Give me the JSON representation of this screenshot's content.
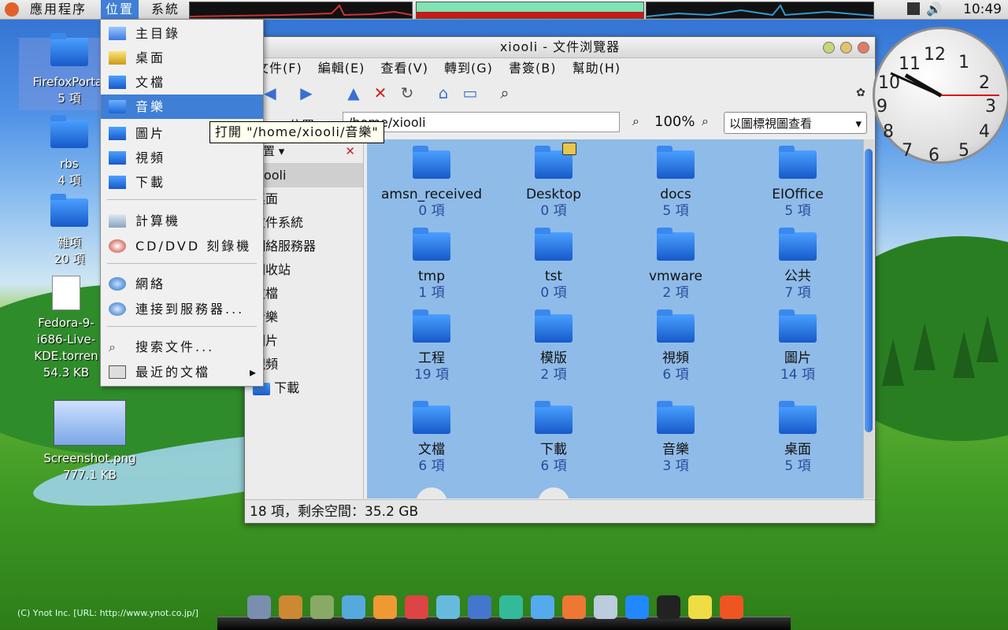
{
  "panel": {
    "applications": "應用程序",
    "places": "位置",
    "system": "系統",
    "time": "10:49"
  },
  "desktop": {
    "icons": [
      {
        "name": "FirefoxPortal",
        "sub": "5 項"
      },
      {
        "name": "rbs",
        "sub": "4 項"
      },
      {
        "name": "雜項",
        "sub": "20 項"
      },
      {
        "name": "Fedora-9-i686-Live-KDE.torrent",
        "line1": "Fedora-9-",
        "line2": "i686-Live-",
        "line3": "KDE.torren",
        "sub": "54.3 KB"
      },
      {
        "name": "Screenshot.png",
        "sub": "777.1 KB"
      }
    ],
    "credit": "(C) Ynot Inc. [URL: http://www.ynot.co.jp/]"
  },
  "places_menu": {
    "items": [
      {
        "label": "主目錄",
        "icon": "home-folder-icon"
      },
      {
        "label": "桌面",
        "icon": "desktop-icon"
      },
      {
        "label": "文檔",
        "icon": "folder-icon"
      },
      {
        "label": "音樂",
        "icon": "folder-icon"
      },
      {
        "label": "圖片",
        "icon": "folder-icon"
      },
      {
        "label": "視頻",
        "icon": "folder-icon"
      },
      {
        "label": "下載",
        "icon": "folder-icon"
      },
      {
        "label": "計算機",
        "icon": "computer-icon"
      },
      {
        "label": "CD/DVD 刻錄機",
        "icon": "cd-icon"
      },
      {
        "label": "網絡",
        "icon": "network-icon"
      },
      {
        "label": "連接到服務器...",
        "icon": "server-icon"
      },
      {
        "label": "搜索文件...",
        "icon": "search-icon"
      },
      {
        "label": "最近的文檔",
        "icon": "recent-icon"
      }
    ],
    "tooltip": "打開 \"/home/xiooli/音樂\""
  },
  "browser": {
    "title": "xiooli - 文件浏覽器",
    "menus": [
      "文件(F)",
      "編輯(E)",
      "查看(V)",
      "轉到(G)",
      "書簽(B)",
      "幫助(H)"
    ],
    "location_label": "位置",
    "location": "/home/xiooli",
    "zoom": "100%",
    "view_mode": "以圖標視圖查看",
    "sidebar_header": "位置",
    "sidebar_items": [
      "xiooli",
      "桌面",
      "文件系統",
      "網絡服務器",
      "回收站",
      "文檔",
      "音樂",
      "圖片",
      "視頻",
      "下載"
    ],
    "files": [
      {
        "name": "amsn_received",
        "count": "0 項"
      },
      {
        "name": "Desktop",
        "count": "0 項"
      },
      {
        "name": "docs",
        "count": "5 項"
      },
      {
        "name": "EIOffice",
        "count": "5 項"
      },
      {
        "name": "tmp",
        "count": "1 項"
      },
      {
        "name": "tst",
        "count": "0 項"
      },
      {
        "name": "vmware",
        "count": "2 項"
      },
      {
        "name": "公共",
        "count": "7 項"
      },
      {
        "name": "工程",
        "count": "19 項"
      },
      {
        "name": "模版",
        "count": "2 項"
      },
      {
        "name": "視頻",
        "count": "6 項"
      },
      {
        "name": "圖片",
        "count": "14 項"
      },
      {
        "name": "文檔",
        "count": "6 項"
      },
      {
        "name": "下載",
        "count": "6 項"
      },
      {
        "name": "音樂",
        "count": "3 項"
      },
      {
        "name": "桌面",
        "count": "5 項"
      }
    ],
    "status": "18 項，剩余空間：35.2 GB"
  },
  "clock": {
    "hour_hand_deg": 300,
    "minute_hand_deg": 294,
    "second_hand_deg": 90
  }
}
